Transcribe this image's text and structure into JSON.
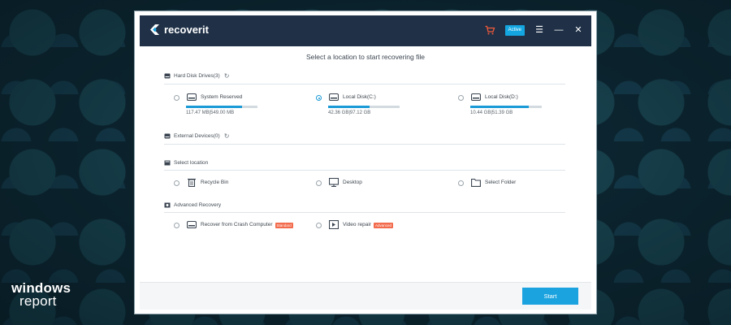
{
  "watermark": {
    "line1": "windows",
    "line2": "report"
  },
  "app": {
    "name": "recoverit",
    "active_label": "Active"
  },
  "icons": {
    "cart": "cart-icon",
    "menu": "menu-icon",
    "minimize": "minimize-icon",
    "close": "close-icon",
    "refresh": "refresh-icon"
  },
  "colors": {
    "accent": "#1a9ad6",
    "titlebar": "#1f3047",
    "tag": "#f26b4c",
    "cart": "#f25a3a"
  },
  "main": {
    "heading": "Select a location to start recovering file",
    "hard_disk_title": "Hard Disk Drives(3)",
    "drives": [
      {
        "label": "System Reserved",
        "size": "117.47  MB|549.00  MB",
        "used_fraction": 0.78,
        "selected": false
      },
      {
        "label": "Local Disk(C:)",
        "size": "42.36  GB|97.12  GB",
        "used_fraction": 0.58,
        "selected": true
      },
      {
        "label": "Local Disk(D:)",
        "size": "10.44  GB|51.39  GB",
        "used_fraction": 0.82,
        "selected": false
      }
    ],
    "external_title": "External Devices(0)",
    "location_title": "Select location",
    "locations": [
      {
        "label": "Recycle Bin"
      },
      {
        "label": "Desktop"
      },
      {
        "label": "Select Folder"
      }
    ],
    "advanced_title": "Advanced Recovery",
    "advanced": [
      {
        "label": "Recover from Crash Computer",
        "tag": "Standard"
      },
      {
        "label": "Video repair",
        "tag": "Advanced"
      }
    ]
  },
  "footer": {
    "start_label": "Start"
  }
}
